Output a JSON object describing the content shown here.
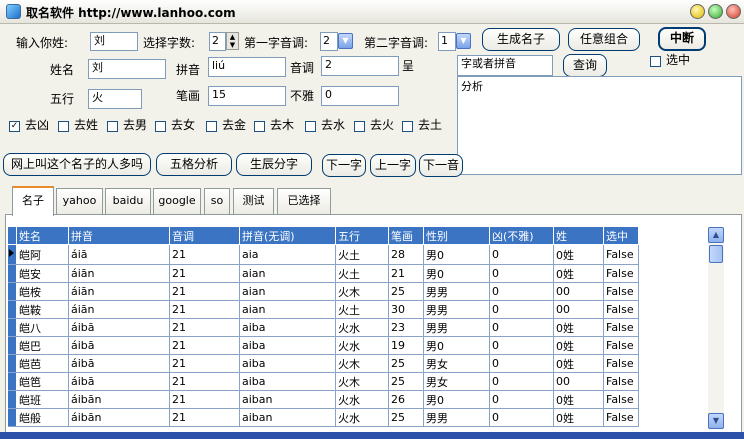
{
  "window": {
    "title": "取名软件 http://www.lanhoo.com"
  },
  "form": {
    "surname_label": "输入你姓:",
    "surname_value": "刘",
    "count_label": "选择字数:",
    "count_value": "2",
    "first_tone_label": "第一字音调:",
    "first_tone_value": "2",
    "second_tone_label": "第二字音调:",
    "second_tone_value": "1",
    "generate_button": "生成名子",
    "random_button": "任意组合",
    "stop_button": "中断",
    "name_label": "姓名",
    "name_value": "刘",
    "pinyin_label": "拼音",
    "pinyin_value": "liú",
    "tone_label": "音调",
    "tone_value": "2",
    "cheng_label": "呈",
    "wuxing_label": "五行",
    "wuxing_value": "火",
    "strokes_label": "笔画",
    "strokes_value": "15",
    "indecent_label": "不雅",
    "indecent_value": "0",
    "query_placeholder": "字或者拼音",
    "query_button": "查询",
    "selected_label": "选中",
    "analysis_text": "分析"
  },
  "filters": [
    {
      "label": "去凶",
      "checked": true
    },
    {
      "label": "去姓",
      "checked": false
    },
    {
      "label": "去男",
      "checked": false
    },
    {
      "label": "去女",
      "checked": false
    },
    {
      "label": "去金",
      "checked": false
    },
    {
      "label": "去木",
      "checked": false
    },
    {
      "label": "去水",
      "checked": false
    },
    {
      "label": "去火",
      "checked": false
    },
    {
      "label": "去土",
      "checked": false
    }
  ],
  "actions": {
    "online_count": "网上叫这个名子的人多吗",
    "five_grid": "五格分析",
    "birth_char": "生辰分字",
    "next_char": "下一字",
    "prev_char": "上一字",
    "next_tone": "下一音"
  },
  "tabs": [
    "名子",
    "yahoo",
    "baidu",
    "google",
    "so",
    "测试",
    "已选择"
  ],
  "table": {
    "columns": [
      "姓名",
      "拼音",
      "音调",
      "拼音(无调)",
      "五行",
      "笔画",
      "性别",
      "凶(不雅)",
      "姓",
      "选中"
    ],
    "rows": [
      [
        "皑阿",
        "áiā",
        "21",
        "aia",
        "火土",
        "28",
        "男0",
        "0",
        "0姓",
        "False"
      ],
      [
        "皑安",
        "áiān",
        "21",
        "aian",
        "火土",
        "21",
        "男0",
        "0",
        "0姓",
        "False"
      ],
      [
        "皑桉",
        "áiān",
        "21",
        "aian",
        "火木",
        "25",
        "男男",
        "0",
        "00",
        "False"
      ],
      [
        "皑鞍",
        "áiān",
        "21",
        "aian",
        "火土",
        "30",
        "男男",
        "0",
        "00",
        "False"
      ],
      [
        "皑八",
        "áibā",
        "21",
        "aiba",
        "火水",
        "23",
        "男男",
        "0",
        "0姓",
        "False"
      ],
      [
        "皑巴",
        "áibā",
        "21",
        "aiba",
        "火水",
        "19",
        "男0",
        "0",
        "0姓",
        "False"
      ],
      [
        "皑芭",
        "áibā",
        "21",
        "aiba",
        "火木",
        "25",
        "男女",
        "0",
        "0姓",
        "False"
      ],
      [
        "皑笆",
        "áibā",
        "21",
        "aiba",
        "火木",
        "25",
        "男女",
        "0",
        "00",
        "False"
      ],
      [
        "皑班",
        "áibān",
        "21",
        "aiban",
        "火水",
        "26",
        "男0",
        "0",
        "0姓",
        "False"
      ],
      [
        "皑般",
        "áibān",
        "21",
        "aiban",
        "火水",
        "25",
        "男男",
        "0",
        "0姓",
        "False"
      ]
    ]
  }
}
